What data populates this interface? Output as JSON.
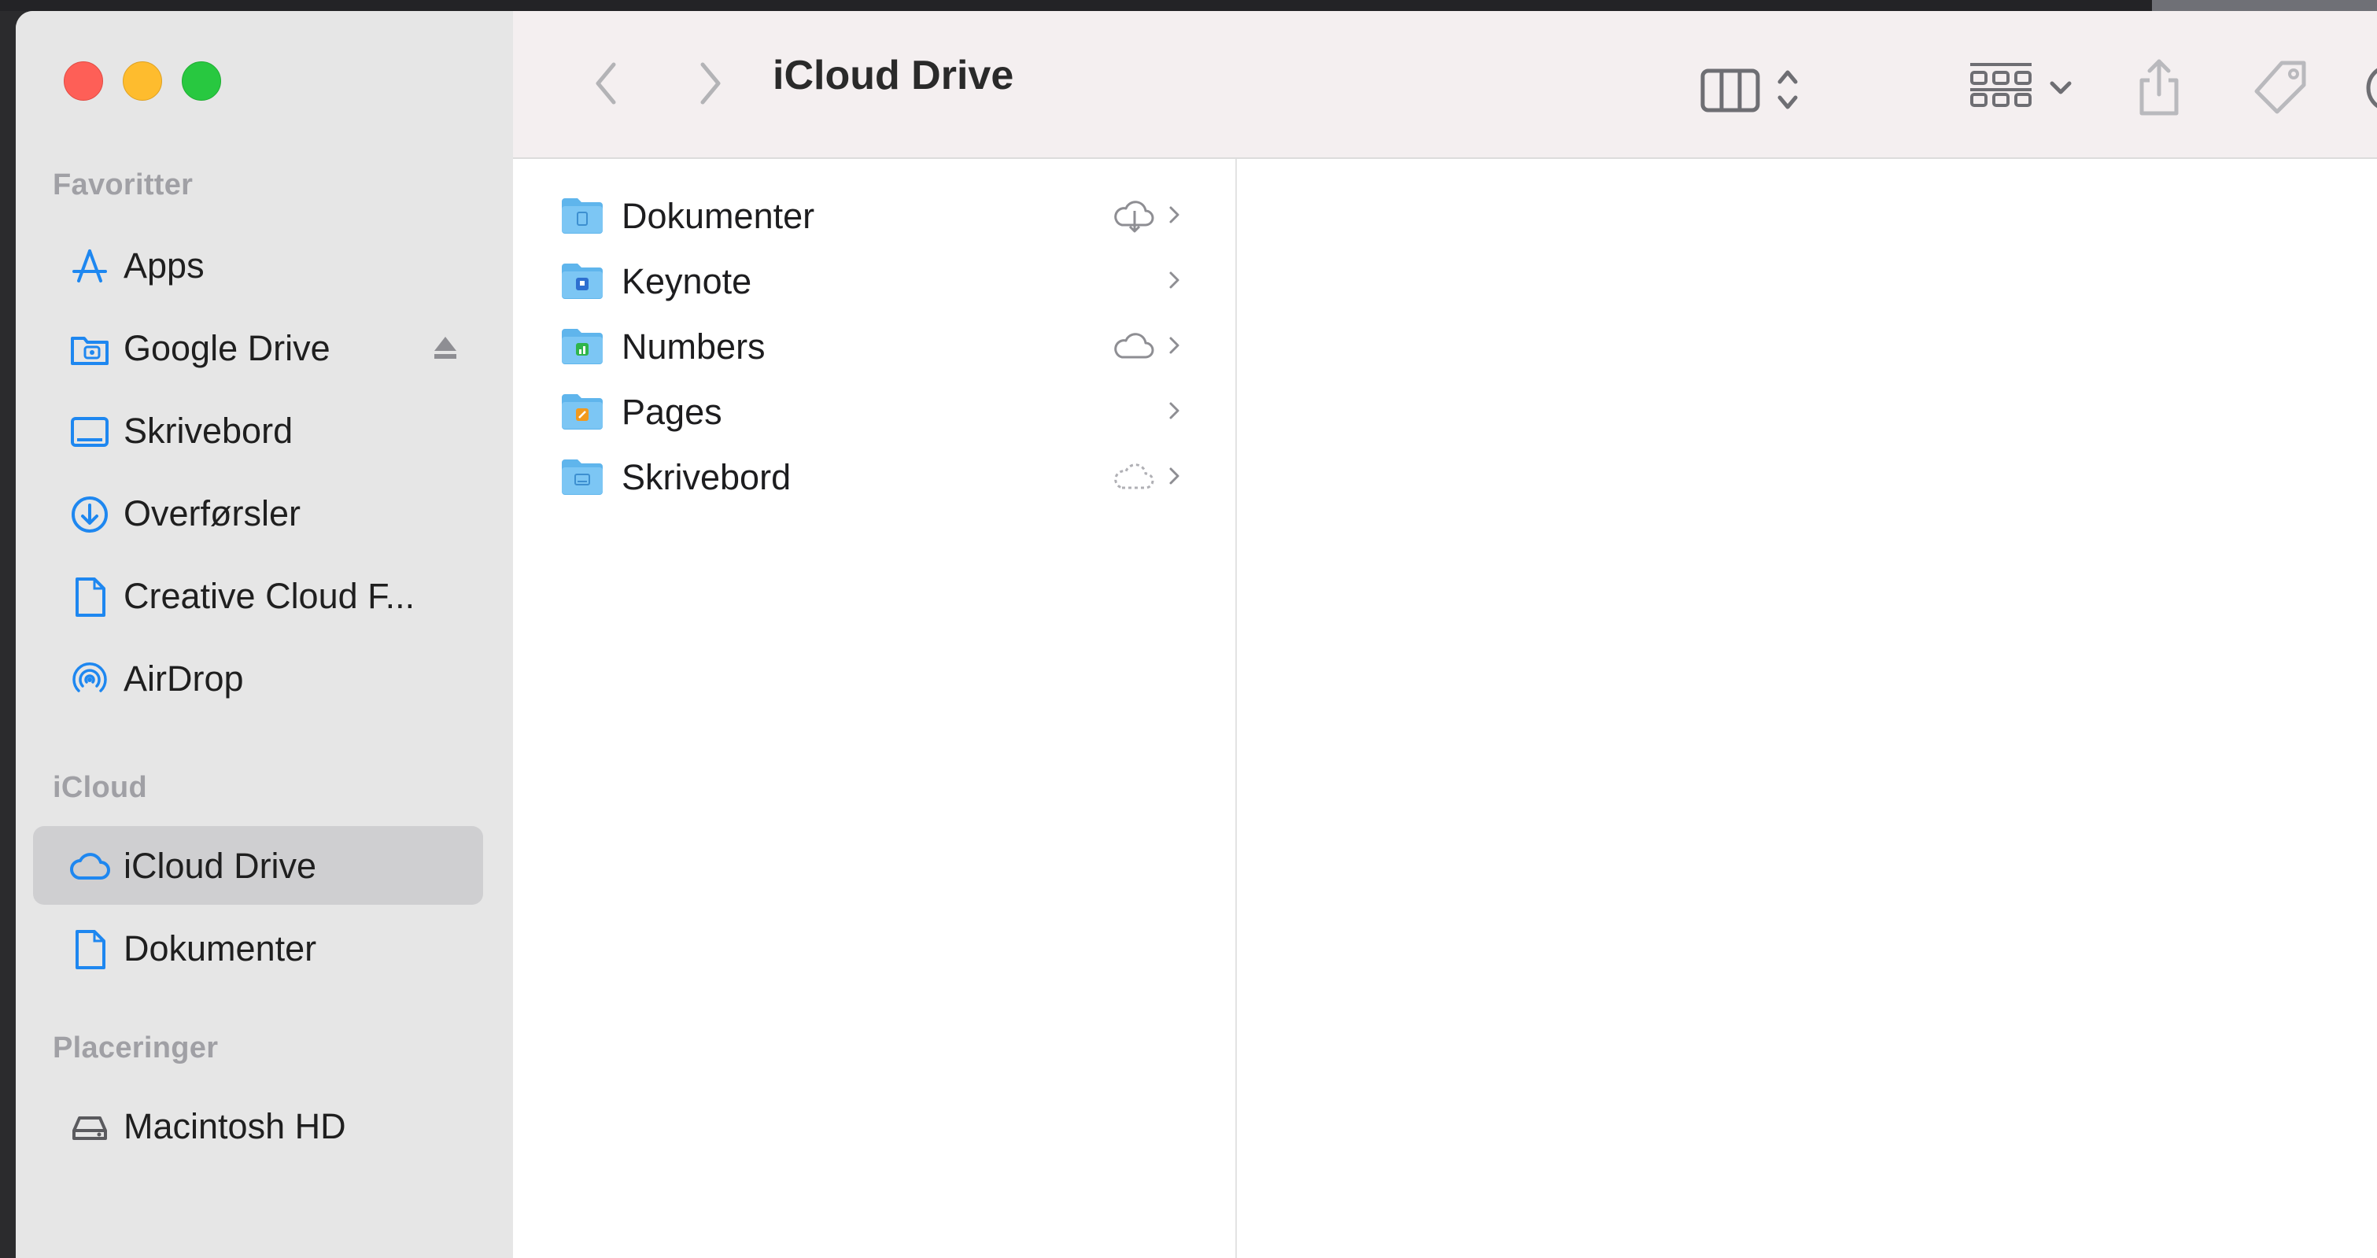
{
  "window": {
    "title": "iCloud Drive"
  },
  "sidebar": {
    "sections": [
      {
        "title": "Favoritter"
      },
      {
        "title": "iCloud"
      },
      {
        "title": "Placeringer"
      }
    ],
    "favorites": [
      {
        "label": "Apps",
        "icon": "apps-icon"
      },
      {
        "label": "Google Drive",
        "icon": "folder-drive-icon",
        "eject": true
      },
      {
        "label": "Skrivebord",
        "icon": "desktop-icon"
      },
      {
        "label": "Overførsler",
        "icon": "download-icon"
      },
      {
        "label": "Creative Cloud F...",
        "icon": "document-icon"
      },
      {
        "label": "AirDrop",
        "icon": "airdrop-icon"
      }
    ],
    "icloud": [
      {
        "label": "iCloud Drive",
        "icon": "cloud-icon",
        "selected": true
      },
      {
        "label": "Dokumenter",
        "icon": "document-icon"
      }
    ],
    "locations": [
      {
        "label": "Macintosh HD",
        "icon": "hard-drive-icon"
      }
    ]
  },
  "toolbar": {
    "back": "back-chevron-icon",
    "forward": "forward-chevron-icon",
    "view_mode": "column-view-icon",
    "group": "group-icon",
    "share": "share-icon",
    "tag": "tag-icon"
  },
  "files": [
    {
      "name": "Dokumenter",
      "status": "cloud-download-icon"
    },
    {
      "name": "Keynote",
      "status": ""
    },
    {
      "name": "Numbers",
      "status": "cloud-icon"
    },
    {
      "name": "Pages",
      "status": ""
    },
    {
      "name": "Skrivebord",
      "status": "cloud-dashed-icon"
    }
  ],
  "colors": {
    "accent": "#1e87f0",
    "folder": "#5fb5ec",
    "sidebar_bg": "#e6e6e6",
    "selection": "#cfcfd1",
    "toolbar_bg": "#f4eff0"
  }
}
